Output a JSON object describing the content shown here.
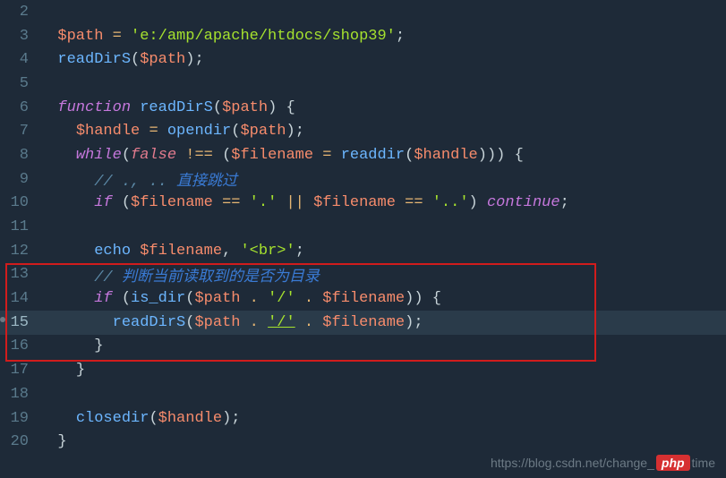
{
  "lines": {
    "2": {
      "num": "2"
    },
    "3": {
      "num": "3",
      "var1": "$path",
      "op": "=",
      "str": "'e:/amp/apache/htdocs/shop39'",
      "end": ";"
    },
    "4": {
      "num": "4",
      "fn": "readDirS",
      "lp": "(",
      "arg": "$path",
      "rp": ")",
      "end": ";"
    },
    "5": {
      "num": "5"
    },
    "6": {
      "num": "6",
      "kw": "function",
      "fn": "readDirS",
      "lp": "(",
      "arg": "$path",
      "rp": ") ",
      "brace": "{"
    },
    "7": {
      "num": "7",
      "var1": "$handle",
      "op": "=",
      "fn": "opendir",
      "lp": "(",
      "arg": "$path",
      "rp": ")",
      "end": ";"
    },
    "8": {
      "num": "8",
      "kw": "while",
      "lp": "(",
      "bool": "false",
      "neq": "!==",
      "lp2": "(",
      "var1": "$filename",
      "op": "=",
      "fn": "readdir",
      "lp3": "(",
      "arg": "$handle",
      "rp3": ")",
      "rp2": ")",
      "rp": ") ",
      "brace": "{"
    },
    "9": {
      "num": "9",
      "cmt": "// ., .. ",
      "cmt_cn": "直接跳过"
    },
    "10": {
      "num": "10",
      "kw": "if",
      "lp": " (",
      "var1": "$filename",
      "op": "==",
      "str1": "'.'",
      "or": "||",
      "var2": "$filename",
      "op2": "==",
      "str2": "'..'",
      "rp": ") ",
      "cont": "continue",
      "end": ";"
    },
    "11": {
      "num": "11"
    },
    "12": {
      "num": "12",
      "echo": "echo",
      "var1": "$filename",
      "comma": ", ",
      "str": "'<br>'",
      "end": ";"
    },
    "13": {
      "num": "13",
      "cmt": "// ",
      "cmt_cn": "判断当前读取到的是否为目录"
    },
    "14": {
      "num": "14",
      "kw": "if",
      "lp": " (",
      "fn": "is_dir",
      "lp2": "(",
      "var1": "$path",
      "dot": ".",
      "str": "'/'",
      "dot2": ".",
      "var2": "$filename",
      "rp2": ")",
      "rp": ") ",
      "brace": "{"
    },
    "15": {
      "num": "15",
      "fn": "readDirS",
      "lp": "(",
      "var1": "$path",
      "dot": ".",
      "str": "'/'",
      "dot2": ".",
      "var2": "$filename",
      "rp": ")",
      "end": ";"
    },
    "16": {
      "num": "16",
      "brace": "}"
    },
    "17": {
      "num": "17",
      "brace": "}"
    },
    "18": {
      "num": "18"
    },
    "19": {
      "num": "19",
      "fn": "closedir",
      "lp": "(",
      "arg": "$handle",
      "rp": ")",
      "end": ";"
    },
    "20": {
      "num": "20",
      "brace": "}"
    }
  },
  "watermark": {
    "prefix": "https://blog.csdn.net/change_",
    "badge": "php",
    "suffix": "time"
  }
}
